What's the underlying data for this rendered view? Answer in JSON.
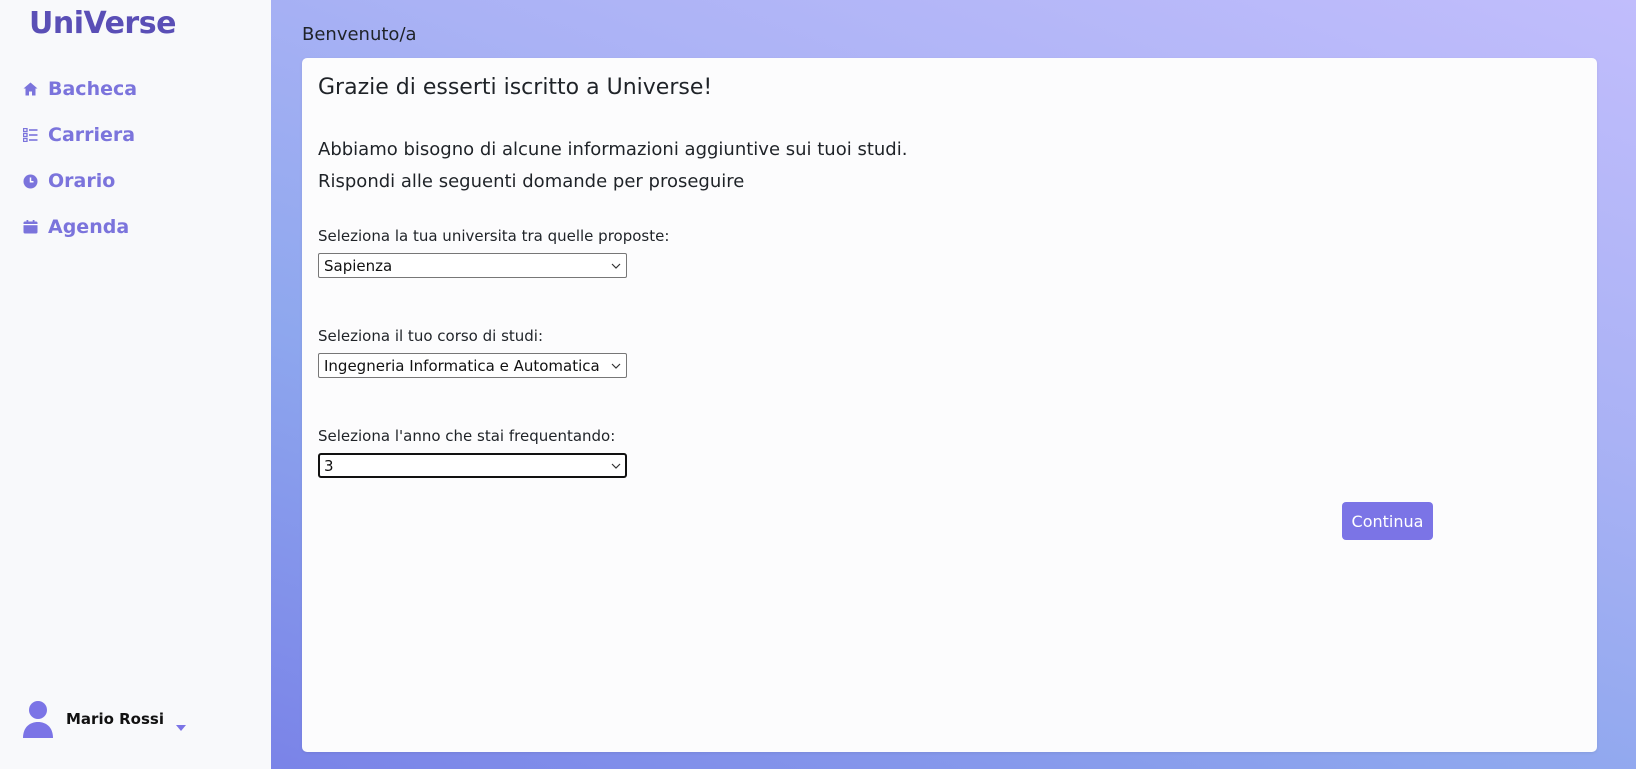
{
  "app": {
    "logo": "UniVerse"
  },
  "sidebar": {
    "items": [
      {
        "label": "Bacheca",
        "icon": "home-icon"
      },
      {
        "label": "Carriera",
        "icon": "list-icon"
      },
      {
        "label": "Orario",
        "icon": "clock-icon"
      },
      {
        "label": "Agenda",
        "icon": "calendar-icon"
      }
    ],
    "user": {
      "name": "Mario Rossi",
      "icon": "user-avatar-icon"
    }
  },
  "header": {
    "greeting": "Benvenuto/a"
  },
  "form": {
    "title": "Grazie di esserti iscritto a Universe!",
    "subtitle_1": "Abbiamo bisogno di alcune informazioni aggiuntive sui tuoi studi.",
    "subtitle_2": "Rispondi alle seguenti domande per proseguire",
    "university": {
      "label": "Seleziona la tua universita tra quelle proposte:",
      "value": "Sapienza"
    },
    "course": {
      "label": "Seleziona il tuo corso di studi:",
      "value": "Ingegneria Informatica e Automatica"
    },
    "year": {
      "label": "Seleziona l'anno che stai frequentando:",
      "value": "3"
    },
    "submit_label": "Continua"
  },
  "colors": {
    "accent": "#7b74e6",
    "logo": "#5a4fb6",
    "nav_text": "#7b74dc"
  }
}
